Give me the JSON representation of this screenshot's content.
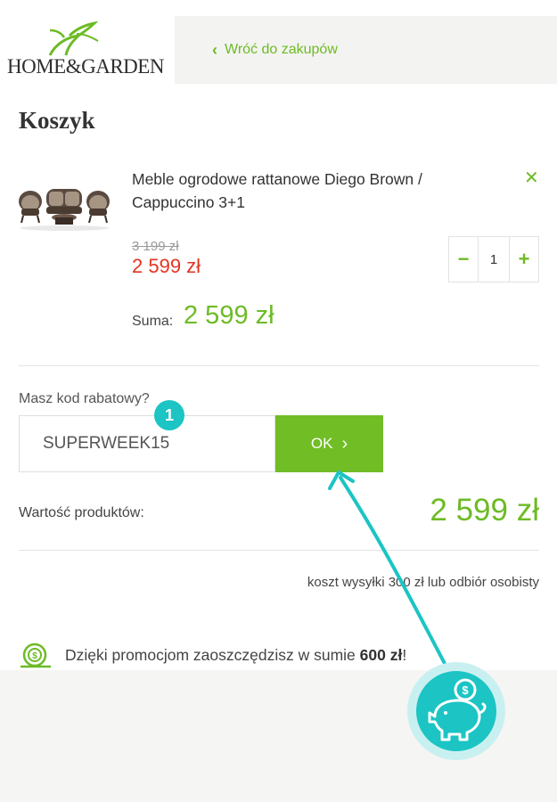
{
  "header": {
    "logo_text": "HOME&GARDEN",
    "back_link": "Wróć do zakupów"
  },
  "page_title": "Koszyk",
  "product": {
    "name": "Meble ogrodowe rattanowe Diego Brown / Cappuccino 3+1",
    "old_price": "3 199 zł",
    "new_price": "2 599 zł",
    "quantity": "1",
    "sum_label": "Suma:",
    "sum_value": "2 599 zł",
    "remove_icon": "close-icon"
  },
  "discount": {
    "label": "Masz kod rabatowy?",
    "code": "SUPERWEEK15",
    "ok_label": "OK",
    "badge_number": "1"
  },
  "totals": {
    "products_label": "Wartość produktów:",
    "products_value": "2 599 zł",
    "shipping_text": "koszt wysyłki 300 zł lub odbiór osobisty"
  },
  "promo": {
    "text": "Dzięki promocjom zaoszczędzisz w sumie",
    "amount": "600 zł",
    "suffix": "!"
  },
  "colors": {
    "green": "#6dbb25",
    "red": "#e53322",
    "teal": "#1cc4c4"
  }
}
